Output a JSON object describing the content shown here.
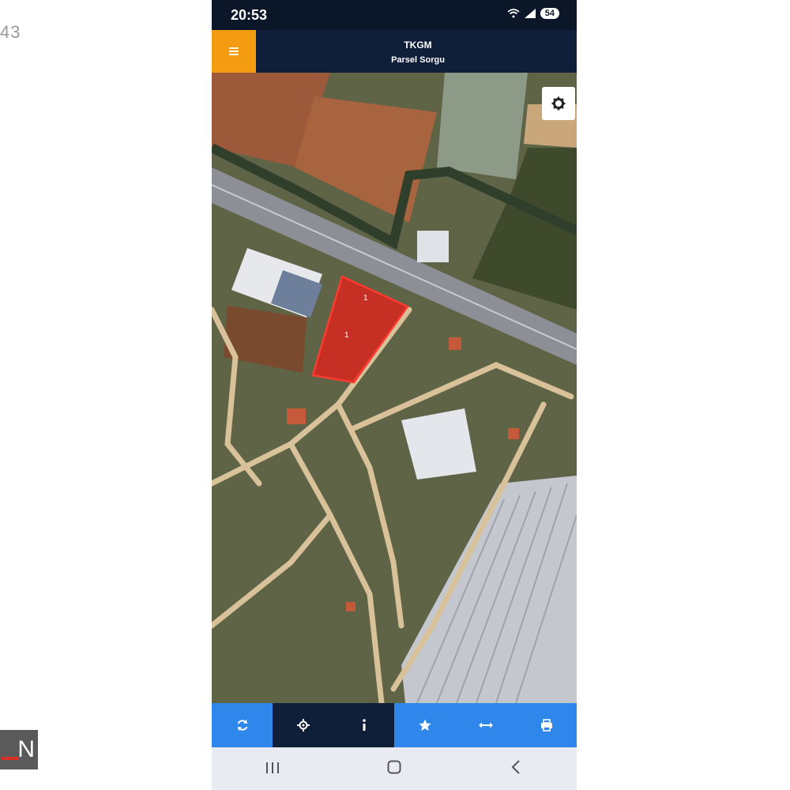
{
  "page": {
    "corner_text": "43",
    "watermark_text": "N"
  },
  "status": {
    "time": "20:53",
    "battery": "54"
  },
  "app": {
    "title": "TKGM",
    "subtitle": "Parsel Sorgu"
  },
  "map": {
    "parcel_labels": [
      "1",
      "1"
    ],
    "parcel_color": "#d7261e",
    "road_color": "#d9c29a"
  },
  "toolbar": {
    "items": [
      {
        "icon": "refresh-icon"
      },
      {
        "icon": "locate-icon"
      },
      {
        "icon": "info-icon"
      },
      {
        "icon": "star-icon"
      },
      {
        "icon": "measure-icon"
      },
      {
        "icon": "print-icon"
      }
    ]
  },
  "navbar": {
    "items": [
      {
        "icon": "recent-apps-icon"
      },
      {
        "icon": "home-icon"
      },
      {
        "icon": "back-icon"
      }
    ]
  },
  "colors": {
    "accent": "#f39c12",
    "toolbar_blue": "#2f86eb",
    "header_navy": "#0f1f3a"
  }
}
